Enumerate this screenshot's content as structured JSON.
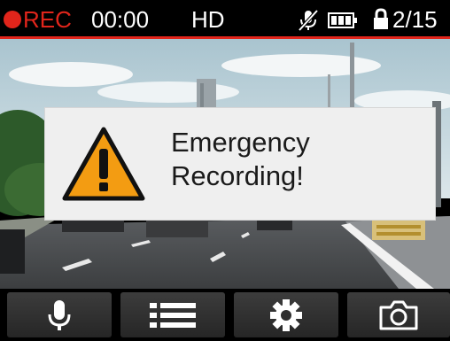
{
  "status_bar": {
    "rec_label": "REC",
    "rec_time": "00:00",
    "quality": "HD",
    "file_count": "2/15",
    "icons": {
      "record_indicator": "record-dot-icon",
      "audio": "mic-off-icon",
      "battery": "battery-icon",
      "protected": "lock-icon"
    }
  },
  "dialog": {
    "message": "Emergency\nRecording!",
    "icon": "warning-icon"
  },
  "toolbar": {
    "buttons": [
      {
        "name": "microphone-button",
        "icon": "microphone-icon"
      },
      {
        "name": "menu-button",
        "icon": "list-icon"
      },
      {
        "name": "settings-button",
        "icon": "gear-icon"
      },
      {
        "name": "snapshot-button",
        "icon": "camera-icon"
      }
    ]
  },
  "colors": {
    "rec_red": "#e1251b",
    "warning_orange": "#f39c12",
    "dialog_bg": "#efefef",
    "toolbar_button": "#333333"
  }
}
